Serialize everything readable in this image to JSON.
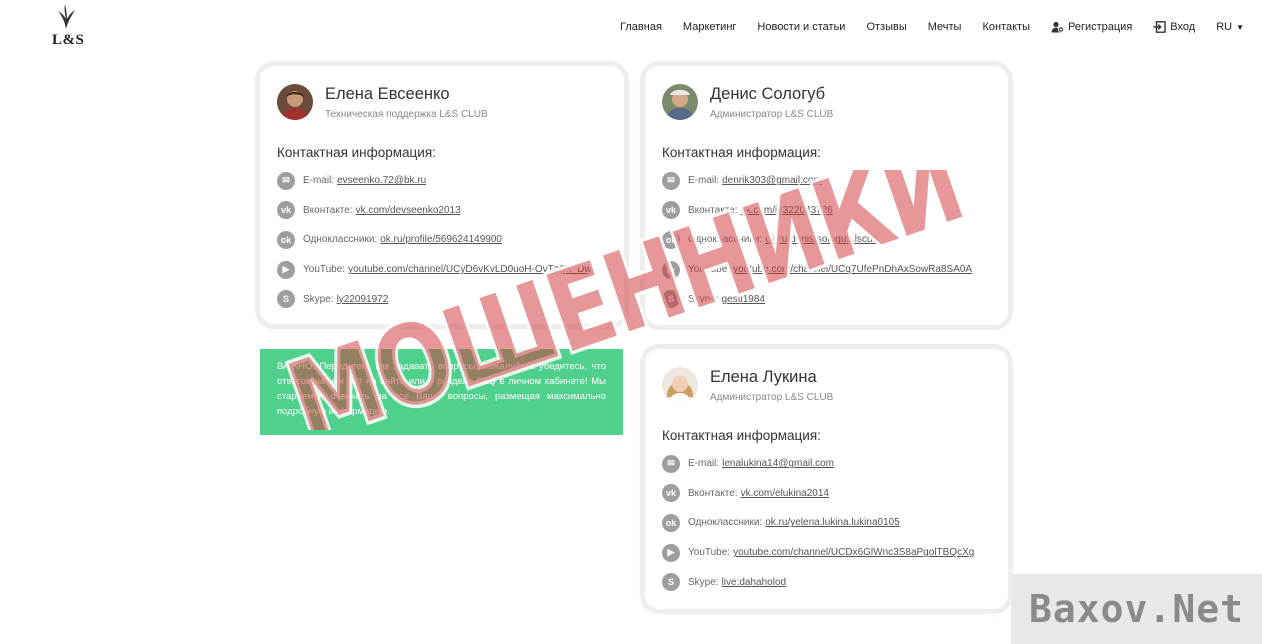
{
  "header": {
    "logo_text": "L&S",
    "nav": [
      {
        "label": "Главная"
      },
      {
        "label": "Маркетинг"
      },
      {
        "label": "Новости и статьи"
      },
      {
        "label": "Отзывы"
      },
      {
        "label": "Мечты"
      },
      {
        "label": "Контакты"
      },
      {
        "label": "Регистрация",
        "icon": "add-user-icon"
      },
      {
        "label": "Вход",
        "icon": "login-icon"
      },
      {
        "label": "RU",
        "icon": "caret-down-icon"
      }
    ]
  },
  "cards": [
    {
      "name": "Елена Евсеенко",
      "role": "Техническая поддержка L&S CLUB",
      "contact_title": "Контактная информация:",
      "rows": [
        {
          "icon": "email-icon",
          "label": "E-mail:",
          "value": "evseenko.72@bk.ru"
        },
        {
          "icon": "vk-icon",
          "label": "Вконтакте:",
          "value": "vk.com/devseenko2013"
        },
        {
          "icon": "odnoklassniki-icon",
          "label": "Одноклассники:",
          "value": "ok.ru/profile/569624149900"
        },
        {
          "icon": "youtube-icon",
          "label": "YouTube:",
          "value": "youtube.com/channel/UCyD6vKvLD0uoH-OvTzQx_Dw"
        },
        {
          "icon": "skype-icon",
          "label": "Skype:",
          "value": "ly22091972"
        }
      ]
    },
    {
      "name": "Денис Сологуб",
      "role": "Администратор L&S CLUB",
      "contact_title": "Контактная информация:",
      "rows": [
        {
          "icon": "email-icon",
          "label": "E-mail:",
          "value": "denrik303@gmail.com"
        },
        {
          "icon": "vk-icon",
          "label": "Вконтакте:",
          "value": "vk.com/id322043726"
        },
        {
          "icon": "odnoklassniki-icon",
          "label": "Одноклассники:",
          "value": "ok.ru/denis.sologub.lscub"
        },
        {
          "icon": "youtube-icon",
          "label": "YouTube:",
          "value": "youtube.com/channel/UCq7UfePnDhAxSowRa8SA0A"
        },
        {
          "icon": "skype-icon",
          "label": "Skype:",
          "value": "gesti1984"
        }
      ]
    },
    {
      "name": "Елена Лукина",
      "role": "Администратор L&S CLUB",
      "contact_title": "Контактная информация:",
      "rows": [
        {
          "icon": "email-icon",
          "label": "E-mail:",
          "value": "lenalukina14@gmail.com"
        },
        {
          "icon": "vk-icon",
          "label": "Вконтакте:",
          "value": "vk.com/elukina2014"
        },
        {
          "icon": "odnoklassniki-icon",
          "label": "Одноклассники:",
          "value": "ok.ru/yelena.lukina.lukina0105"
        },
        {
          "icon": "youtube-icon",
          "label": "YouTube:",
          "value": "youtube.com/channel/UCDx6GlWnc3S8aPgolTBQcXg"
        },
        {
          "icon": "skype-icon",
          "label": "Skype:",
          "value": "live:dahaholod"
        }
      ]
    }
  ],
  "notice": {
    "text": "ВАЖНО! Перед тем, как задавать вопросы, пожалуйста убедитесь, что ответов на них нет на сайте или в разделе FAQ в личном кабинете! Мы стараемся отвечать на все Ваши вопросы, размещая максимально подробную информацию.",
    "background": "#4fd08d"
  },
  "watermark": {
    "stamp_text": "МОШЕННИКИ",
    "stamp_color": "#d2373c",
    "corner_text": "Baxov.Net"
  }
}
